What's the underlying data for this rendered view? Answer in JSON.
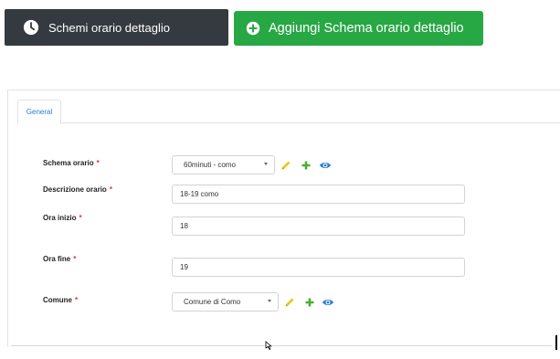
{
  "header": {
    "list_label": "Schemi orario dettaglio",
    "add_label": "Aggiungi Schema orario dettaglio",
    "list_icon": "clock-icon",
    "add_icon": "plus-circle-icon"
  },
  "tabs": [
    {
      "label": "General",
      "active": true
    }
  ],
  "form": {
    "schema_orario": {
      "label": "Schema orario",
      "required_mark": "*",
      "value": "60minuti - como"
    },
    "descrizione_orario": {
      "label": "Descrizione orario",
      "required_mark": "*",
      "value": "18-19 como"
    },
    "ora_inizio": {
      "label": "Ora inizio",
      "required_mark": "*",
      "value": "18"
    },
    "ora_fine": {
      "label": "Ora fine",
      "required_mark": "*",
      "value": "19"
    },
    "comune": {
      "label": "Comune",
      "required_mark": "*",
      "value": "Comune di Como"
    }
  },
  "colors": {
    "dark_button": "#343a40",
    "green_button": "#28a745",
    "edit_icon": "#f0c419",
    "add_icon": "#4cae32",
    "view_icon": "#2b7bd6",
    "required": "#e3342f"
  }
}
